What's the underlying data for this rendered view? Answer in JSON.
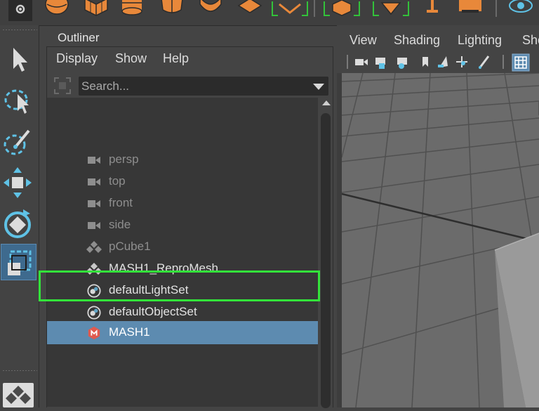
{
  "shelf": {
    "icons": [
      "gear-icon",
      "poly-sphere-icon",
      "poly-cube-icon",
      "poly-cylinder-icon",
      "poly-cone-icon",
      "poly-torus-icon",
      "poly-plane-icon",
      "bevel-icon",
      "poly-platonic-icon",
      "extrude-icon",
      "text-tool-icon",
      "svg-icon",
      "render-icon"
    ]
  },
  "toolbox": {
    "tools": [
      {
        "name": "select-tool",
        "icon": "arrow-icon"
      },
      {
        "name": "lasso-tool",
        "icon": "lasso-icon"
      },
      {
        "name": "paint-select-tool",
        "icon": "brush-icon"
      },
      {
        "name": "move-tool",
        "icon": "move-icon"
      },
      {
        "name": "rotate-tool",
        "icon": "rotate-icon"
      },
      {
        "name": "scale-tool",
        "icon": "scale-icon",
        "active": true
      }
    ]
  },
  "outliner": {
    "tab_label": "Outliner",
    "menu": [
      "Display",
      "Show",
      "Help"
    ],
    "search": {
      "placeholder": "Search..."
    },
    "items": [
      {
        "label": "persp",
        "icon": "camera-icon",
        "dim": true
      },
      {
        "label": "top",
        "icon": "camera-icon",
        "dim": true
      },
      {
        "label": "front",
        "icon": "camera-icon",
        "dim": true
      },
      {
        "label": "side",
        "icon": "camera-icon",
        "dim": true
      },
      {
        "label": "pCube1",
        "icon": "mesh-icon",
        "dim": true
      },
      {
        "label": "MASH1_ReproMesh",
        "icon": "mesh-icon",
        "dim": false
      },
      {
        "label": "defaultLightSet",
        "icon": "set-icon",
        "dim": false
      },
      {
        "label": "defaultObjectSet",
        "icon": "set-icon",
        "dim": false
      },
      {
        "label": "MASH1",
        "icon": "mash-icon",
        "selected": true
      }
    ]
  },
  "viewport": {
    "menu": [
      "View",
      "Shading",
      "Lighting",
      "Sho"
    ],
    "toolbar_icons": [
      "select-camera-icon",
      "camera-lock-icon",
      "camera-attr-icon",
      "bookmark-icon",
      "image-plane-icon",
      "2d-pan-icon",
      "grease-pencil-icon",
      "grid-icon"
    ]
  },
  "colors": {
    "accent_orange": "#e8883a",
    "selection_blue": "#5d8bb0",
    "highlight_green": "#33e33a",
    "tool_cyan": "#5fc2e6",
    "mash_red": "#e05a4f"
  }
}
